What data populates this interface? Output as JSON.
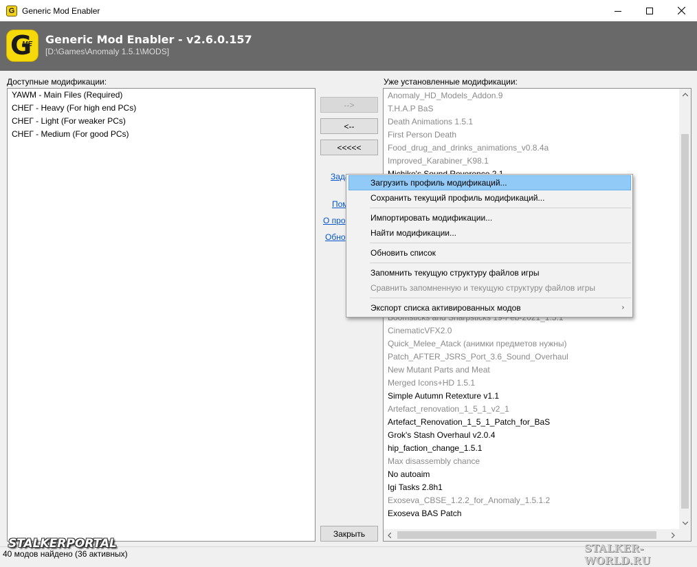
{
  "window": {
    "title": "Generic Mod Enabler",
    "minimize_icon": "minimize-icon",
    "maximize_icon": "maximize-icon",
    "close_icon": "close-icon"
  },
  "banner": {
    "logo_letter": "G",
    "logo_sub": "ME",
    "title": "Generic Mod Enabler - v2.6.0.157",
    "path": "[D:\\Games\\Anomaly 1.5.1\\MODS]"
  },
  "available": {
    "label": "Доступные модификации:",
    "items": [
      "YAWM - Main Files (Required)",
      "СНЕГ - Heavy (For high end PCs)",
      "СНЕГ - Light (For weaker PCs)",
      "СНЕГ - Medium (For good PCs)"
    ]
  },
  "installed": {
    "label": "Уже установленные модификации:",
    "items_top": [
      {
        "text": "Anomaly_HD_Models_Addon.9",
        "active": false
      },
      {
        "text": "T.H.A.P BaS",
        "active": false
      },
      {
        "text": "Death Animations 1.5.1",
        "active": false
      },
      {
        "text": "First Person Death",
        "active": false
      },
      {
        "text": "Food_drug_and_drinks_animations_v0.8.4a",
        "active": false
      },
      {
        "text": "Improved_Karabiner_K98.1",
        "active": false
      },
      {
        "text": "Michiko's Sound Reverence 2.1",
        "active": true
      }
    ],
    "items_bottom": [
      {
        "text": "Boomsticks and Sharpsticks 19-Feb-2021_1.5.1",
        "active": false
      },
      {
        "text": "CinematicVFX2.0",
        "active": false
      },
      {
        "text": "Quick_Melee_Atack (анимки предметов нужны)",
        "active": false
      },
      {
        "text": "Patch_AFTER_JSRS_Port_3.6_Sound_Overhaul",
        "active": false
      },
      {
        "text": "New Mutant Parts and Meat",
        "active": false
      },
      {
        "text": "Merged Icons+HD 1.5.1",
        "active": false
      },
      {
        "text": "Simple Autumn Retexture v1.1",
        "active": true
      },
      {
        "text": "Artefact_renovation_1_5_1_v2_1",
        "active": false
      },
      {
        "text": "Artefact_Renovation_1_5_1_Patch_for_BaS",
        "active": true
      },
      {
        "text": "Grok's Stash Overhaul v2.0.4",
        "active": true
      },
      {
        "text": "hip_faction_change_1.5.1",
        "active": true
      },
      {
        "text": "Max disassembly chance",
        "active": false
      },
      {
        "text": "No autoaim",
        "active": true
      },
      {
        "text": "Igi Tasks 2.8h1",
        "active": true
      },
      {
        "text": "Exoseva_CBSE_1.2.2_for_Anomaly_1.5.1.2",
        "active": false
      },
      {
        "text": "Exoseva BAS Patch",
        "active": true
      }
    ]
  },
  "buttons": {
    "add": "-->",
    "remove": "<--",
    "remove_all": "<<<<<",
    "close": "Закрыть"
  },
  "links": {
    "task": "Зада",
    "help": "Пом",
    "about": "О про",
    "update": "Обно"
  },
  "context_menu": {
    "load_profile": "Загрузить профиль модификаций...",
    "save_profile": "Сохранить текущий профиль модификаций...",
    "import_mods": "Импортировать модификации...",
    "find_mods": "Найти модификации...",
    "refresh": "Обновить список",
    "remember_structure": "Запомнить текущую структуру файлов игры",
    "compare_structure": "Сравнить запомненную и текущую структуру файлов игры",
    "export_list": "Экспорт списка активированных модов",
    "submenu_arrow": "›"
  },
  "status": {
    "text": "40 модов найдено (36 активных)"
  },
  "watermarks": {
    "left": "STALKERPORTAL",
    "right": "STALKER-WORLD.RU"
  }
}
